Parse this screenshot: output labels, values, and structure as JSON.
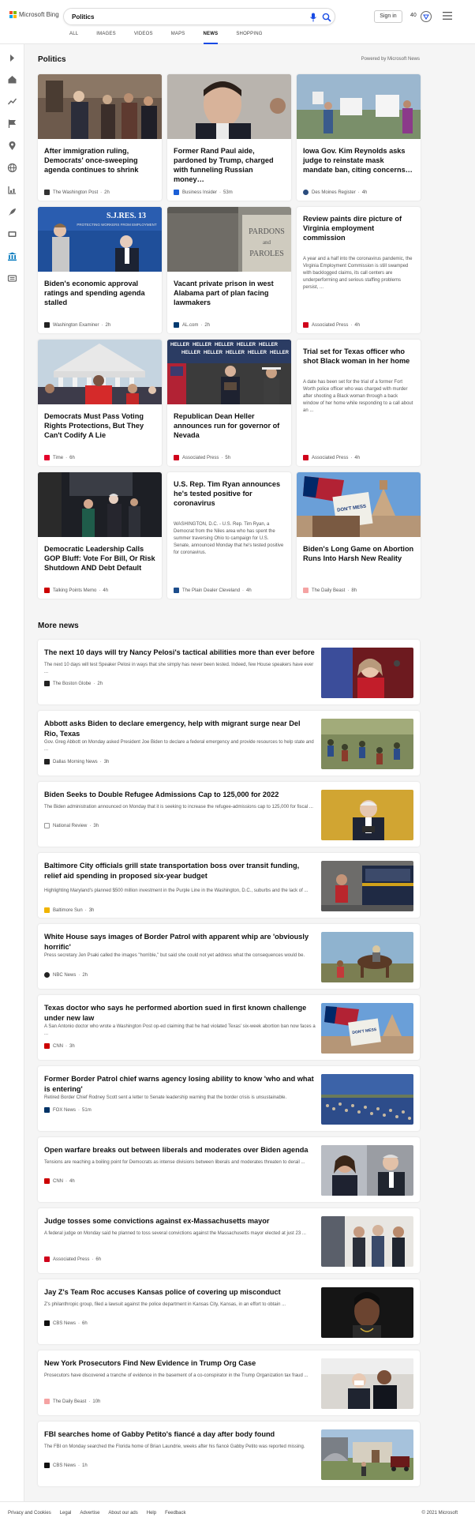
{
  "header": {
    "brand": "Microsoft Bing",
    "logo_colors": [
      "#f25022",
      "#7fba00",
      "#00a4ef",
      "#ffb900"
    ],
    "search_value": "Politics",
    "signin_label": "Sign in",
    "points": "40",
    "accent": "#174ae4"
  },
  "tabs": [
    {
      "label": "ALL"
    },
    {
      "label": "IMAGES"
    },
    {
      "label": "VIDEOS"
    },
    {
      "label": "MAPS"
    },
    {
      "label": "NEWS",
      "active": true
    },
    {
      "label": "SHOPPING"
    }
  ],
  "sidebar": {
    "icons": [
      "expand-arrow-icon",
      "home-icon",
      "trending-icon",
      "flag-icon",
      "location-pin-icon",
      "globe-icon",
      "scale-icon",
      "rocket-icon",
      "entertainment-icon",
      "politics-building-icon",
      "document-icon"
    ]
  },
  "main": {
    "title": "Politics",
    "powered_by": "Powered by Microsoft News",
    "cards": [
      {
        "title": "After immigration ruling, Democrats' once-sweeping agenda continues to shrink",
        "source": "The Washington Post",
        "time": "2h",
        "snippet": ""
      },
      {
        "title": "Former Rand Paul aide, pardoned by Trump, charged with funneling Russian money…",
        "source": "Business Insider",
        "time": "53m",
        "snippet": ""
      },
      {
        "title": "Iowa Gov. Kim Reynolds asks judge to reinstate mask mandate ban, citing concerns…",
        "source": "Des Moines Register",
        "time": "4h",
        "snippet": ""
      },
      {
        "title": "Biden's economic approval ratings and spending agenda stalled",
        "source": "Washington Examiner",
        "time": "2h",
        "snippet": ""
      },
      {
        "title": "Vacant private prison in west Alabama part of plan facing lawmakers",
        "source": "AL.com",
        "time": "2h",
        "snippet": ""
      },
      {
        "title": "Review paints dire picture of Virginia employment commission",
        "source": "Associated Press",
        "time": "4h",
        "snippet": "A year and a half into the coronavirus pandemic, the Virginia Employment Commission is still swamped with backlogged claims, its call centers are underperforming and serious staffing problems persist, ..."
      },
      {
        "title": "Democrats Must Pass Voting Rights Protections, But They Can't Codify A Lie",
        "source": "Time",
        "time": "6h",
        "snippet": ""
      },
      {
        "title": "Republican Dean Heller announces run for governor of Nevada",
        "source": "Associated Press",
        "time": "5h",
        "snippet": ""
      },
      {
        "title": "Trial set for Texas officer who shot Black woman in her home",
        "source": "Associated Press",
        "time": "4h",
        "snippet": "A date has been set for the trial of a former Fort Worth police officer who was charged with murder after shooting a Black woman through a back window of her home while responding to a call about an ..."
      },
      {
        "title": "Democratic Leadership Calls GOP Bluff: Vote For Bill, Or Risk Shutdown AND Debt Default",
        "source": "Talking Points Memo",
        "time": "4h",
        "snippet": ""
      },
      {
        "title": "U.S. Rep. Tim Ryan announces he's tested positive for coronavirus",
        "source": "The Plain Dealer Cleveland",
        "time": "4h",
        "snippet": "WASHINGTON, D.C. - U.S. Rep. Tim Ryan, a Democrat from the Niles area who has spent the summer traversing Ohio to campaign for U.S. Senate, announced Monday that he's tested positive for coronavirus."
      },
      {
        "title": "Biden's Long Game on Abortion Runs Into Harsh New Reality",
        "source": "The Daily Beast",
        "time": "8h",
        "snippet": ""
      }
    ],
    "image_text": {
      "resolution": "S.J.RES. 13",
      "resolution_sub": "PROTECTING WORKERS FROM EMPLOYMENT",
      "pardons_1": "PARDONS",
      "pardons_2": "PAROLES",
      "heller": "HELLER",
      "sign": "DON'T MESS"
    }
  },
  "more_news": {
    "title": "More news",
    "items": [
      {
        "title": "The next 10 days will try Nancy Pelosi's tactical abilities more than ever before",
        "snippet": "The next 10 days will test Speaker Pelosi in ways that she simply has never been tested. Indeed, few House speakers have ever ...",
        "source": "The Boston Globe",
        "time": "2h"
      },
      {
        "title": "Abbott asks Biden to declare emergency, help with migrant surge near Del Rio, Texas",
        "snippet": "Gov. Greg Abbott on Monday asked President Joe Biden to declare a federal emergency and provide resources to help state and ...",
        "source": "Dallas Morning News",
        "time": "3h"
      },
      {
        "title": "Biden Seeks to Double Refugee Admissions Cap to 125,000 for 2022",
        "snippet": "The Biden administration announced on Monday that it is seeking to increase the refugee-admissions cap to 125,000 for fiscal ...",
        "source": "National Review",
        "time": "3h"
      },
      {
        "title": "Baltimore City officials grill state transportation boss over transit funding, relief aid spending in proposed six-year budget",
        "snippet": "Highlighting Maryland's planned $500 million investment in the Purple Line in the Washington, D.C., suburbs and the lack of ...",
        "source": "Baltimore Sun",
        "time": "3h"
      },
      {
        "title": "White House says images of Border Patrol with apparent whip are 'obviously horrific'",
        "snippet": "Press secretary Jen Psaki called the images \"horrible,\" but said she could not yet address what the consequences would be.",
        "source": "NBC News",
        "time": "2h"
      },
      {
        "title": "Texas doctor who says he performed abortion sued in first known challenge under new law",
        "snippet": "A San Antonio doctor who wrote a Washington Post op-ed claiming that he had violated Texas' six-week abortion ban now faces a ...",
        "source": "CNN",
        "time": "3h"
      },
      {
        "title": "Former Border Patrol chief warns agency losing ability to know 'who and what is entering'",
        "snippet": "Retired Border Chief Rodney Scott sent a letter to Senate leadership warning that the border crisis is unsustainable.",
        "source": "FOX News",
        "time": "51m"
      },
      {
        "title": "Open warfare breaks out between liberals and moderates over Biden agenda",
        "snippet": "Tensions are reaching a boiling point for Democrats as intense divisions between liberals and moderates threaten to derail ...",
        "source": "CNN",
        "time": "4h"
      },
      {
        "title": "Judge tosses some convictions against ex-Massachusetts mayor",
        "snippet": "A federal judge on Monday said he planned to toss several convictions against the Massachusetts mayor elected at just 23 ...",
        "source": "Associated Press",
        "time": "6h"
      },
      {
        "title": "Jay Z's Team Roc accuses Kansas police of covering up misconduct",
        "snippet": "Z's philanthropic group, filed a lawsuit against the police department in Kansas City, Kansas, in an effort to obtain ...",
        "source": "CBS News",
        "time": "6h"
      },
      {
        "title": "New York Prosecutors Find New Evidence in Trump Org Case",
        "snippet": "Prosecutors have discovered a tranche of evidence in the basement of a co-conspirator in the Trump Organization tax fraud ...",
        "source": "The Daily Beast",
        "time": "10h"
      },
      {
        "title": "FBI searches home of Gabby Petito's fiancé a day after body found",
        "snippet": "The FBI on Monday searched the Florida home of Brian Laundrie, weeks after his fiancé Gabby Petito was reported missing.",
        "source": "CBS News",
        "time": "1h"
      }
    ]
  },
  "footer": {
    "links": [
      "Privacy and Cookies",
      "Legal",
      "Advertise",
      "About our ads",
      "Help",
      "Feedback"
    ],
    "copyright": "© 2021 Microsoft"
  }
}
